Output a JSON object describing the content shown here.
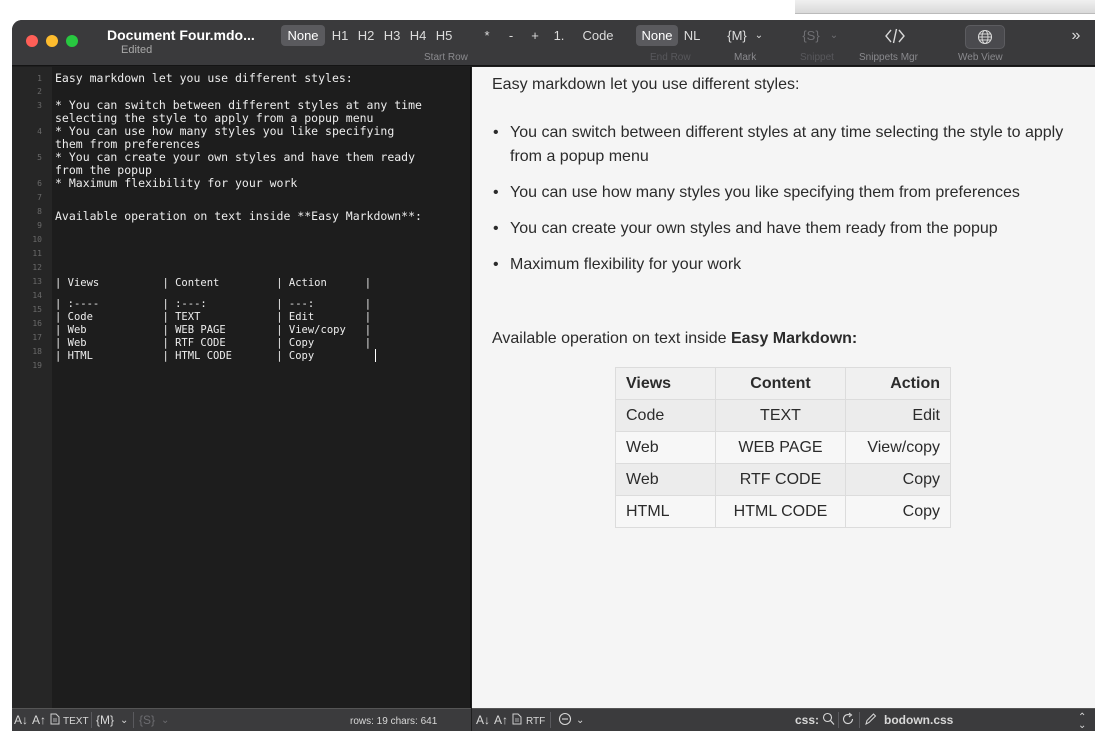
{
  "window": {
    "title": "Document Four.mdo...",
    "subtitle": "Edited"
  },
  "toolbar": {
    "headings": [
      "None",
      "H1",
      "H2",
      "H3",
      "H4",
      "H5"
    ],
    "list_items": [
      "*",
      "-",
      "+",
      "1.",
      "Code"
    ],
    "end_items": [
      "None",
      "NL"
    ],
    "start_row_label": "Start Row",
    "end_row_label": "End Row",
    "mark_value": "{M}",
    "mark_label": "Mark",
    "snippet_value": "{S}",
    "snippet_label": "Snippet",
    "snippets_mgr_label": "Snippets Mgr",
    "web_view_label": "Web View",
    "more": "»"
  },
  "editor": {
    "line_numbers": [
      "1",
      "2",
      "3",
      "4",
      "5",
      "6",
      "7",
      "8",
      "9",
      "10",
      "11",
      "12",
      "13",
      "14",
      "15",
      "16",
      "17",
      "18",
      "19"
    ],
    "lines": [
      "Easy markdown let you use different styles:",
      "* You can switch between different styles at any time",
      "selecting the style to apply from a popup menu",
      "* You can use how many styles you like specifying",
      "them from preferences",
      "* You can create your own styles and have them ready",
      "from the popup",
      "* Maximum flexibility for your work",
      "Available operation on text inside **Easy Markdown**:",
      "| Views          | Content         | Action      |",
      "| :----          | :---:           | ---:        |",
      "| Code           | TEXT            | Edit        |",
      "| Web            | WEB PAGE        | View/copy   |",
      "| Web            | RTF CODE        | Copy        |",
      "| HTML           | HTML CODE       | Copy        "
    ]
  },
  "preview": {
    "intro": "Easy markdown let you use different styles:",
    "bullets": [
      "You can switch between different styles at any time selecting the style to apply from a popup menu",
      "You can use how many styles you like specifying them from preferences",
      "You can create your own styles and have them ready from the popup",
      "Maximum flexibility for your work"
    ],
    "available_prefix": "Available operation on text inside ",
    "available_bold": "Easy Markdown:",
    "table": {
      "headers": [
        "Views",
        "Content",
        "Action"
      ],
      "rows": [
        [
          "Code",
          "TEXT",
          "Edit"
        ],
        [
          "Web",
          "WEB PAGE",
          "View/copy"
        ],
        [
          "Web",
          "RTF CODE",
          "Copy"
        ],
        [
          "HTML",
          "HTML CODE",
          "Copy"
        ]
      ]
    }
  },
  "statusbar_left": {
    "sort_down": "A↓",
    "sort_up": "A↑",
    "format": "TEXT",
    "mark": "{M}",
    "snippet": "{S}",
    "stats": "rows: 19 chars: 641"
  },
  "statusbar_right": {
    "sort_down": "A↓",
    "sort_up": "A↑",
    "format": "RTF",
    "css_label": "css:",
    "css_file": "bodown.css"
  }
}
